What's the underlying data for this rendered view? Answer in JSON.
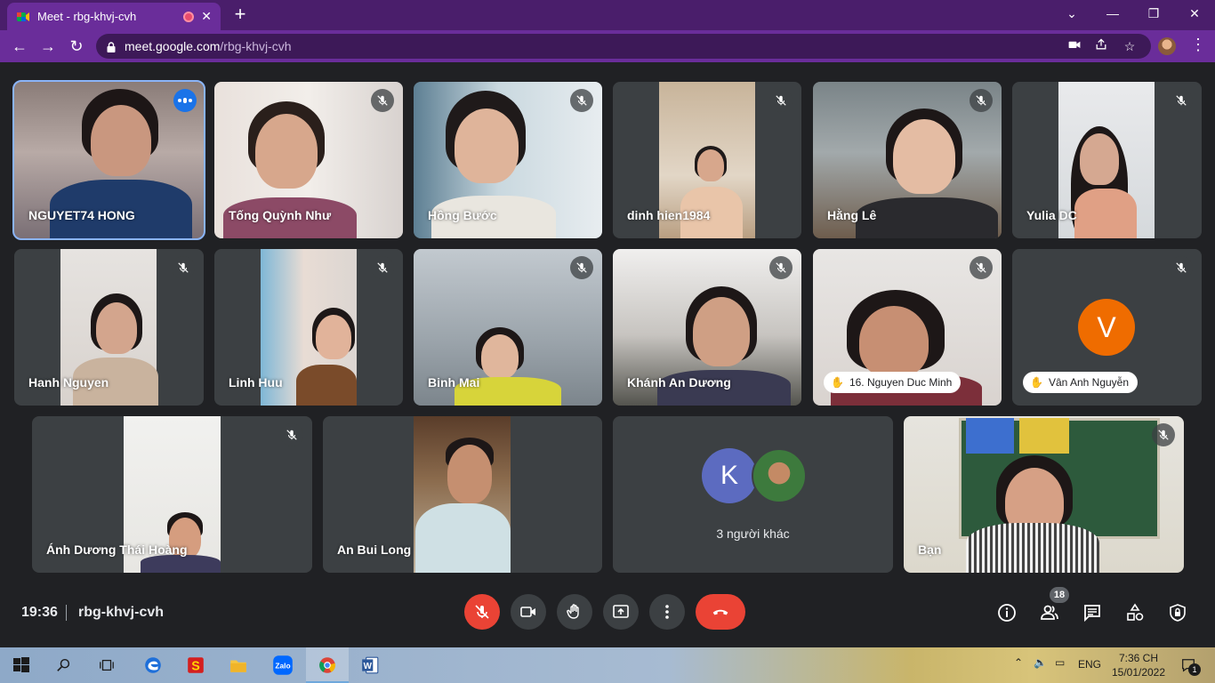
{
  "browser": {
    "tab_title": "Meet - rbg-khvj-cvh",
    "url_host": "meet.google.com",
    "url_path": "/rbg-khvj-cvh"
  },
  "participants": [
    {
      "name": "NGUYET74 HONG"
    },
    {
      "name": "Tống Quỳnh Như"
    },
    {
      "name": "Hồng Bước"
    },
    {
      "name": "dinh hien1984"
    },
    {
      "name": "Hằng Lê"
    },
    {
      "name": "Yulia DC"
    },
    {
      "name": "Hanh Nguyen"
    },
    {
      "name": "Linh Huu"
    },
    {
      "name": "Binh Mai"
    },
    {
      "name": "Khánh An Dương"
    },
    {
      "name": "16. Nguyen Duc Minh"
    },
    {
      "name": "Vân Anh Nguyễn",
      "avatar_letter": "V"
    },
    {
      "name": "Ánh Dương Thái Hoàng"
    },
    {
      "name": "An Bui Long"
    },
    {
      "name": "Bạn"
    }
  ],
  "others_tile": {
    "avatar_letter": "K",
    "label": "3 người khác"
  },
  "bottom": {
    "time": "19:36",
    "meeting_code": "rbg-khvj-cvh",
    "people_count": "18"
  },
  "taskbar": {
    "lang": "ENG",
    "time": "7:36 CH",
    "date": "15/01/2022",
    "notif_count": "1",
    "zalo_label": "Zalo"
  },
  "colors": {
    "accent": "#6a2d9a",
    "hangup": "#ea4335",
    "mic_off": "#ea4335",
    "avatar_v": "#ef6c00",
    "avatar_k": "#5c6bc0"
  }
}
